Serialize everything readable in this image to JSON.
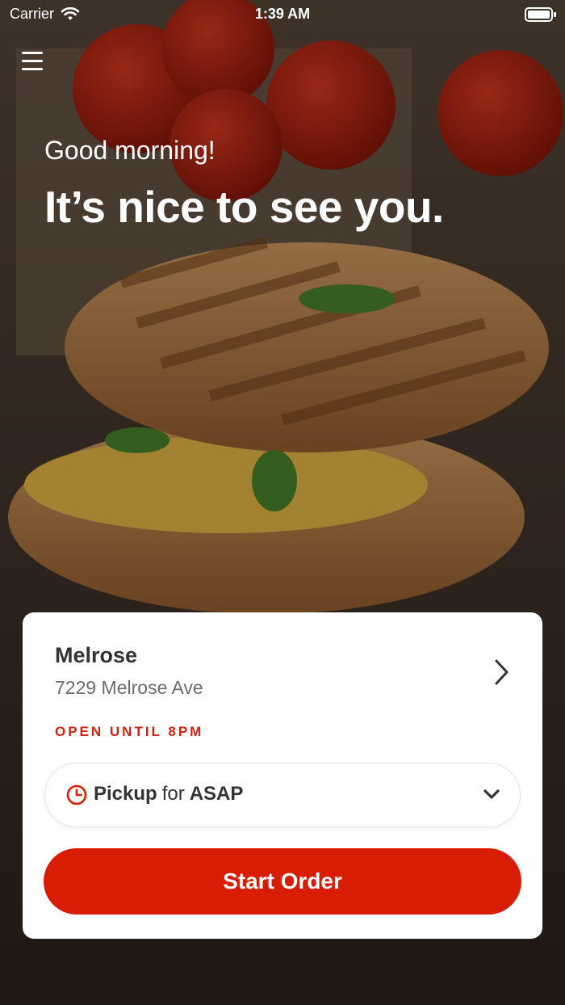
{
  "status_bar": {
    "carrier": "Carrier",
    "time": "1:39 AM"
  },
  "icons": {
    "menu": "hamburger-menu-icon",
    "wifi": "wifi-icon",
    "battery": "battery-icon",
    "chevron_right": "chevron-right-icon",
    "clock": "clock-icon",
    "chevron_down": "chevron-down-icon"
  },
  "hero": {
    "greeting": "Good morning!",
    "headline": "It’s nice to see you."
  },
  "location": {
    "name": "Melrose",
    "address": "7229 Melrose Ave",
    "hours": "OPEN UNTIL 8PM"
  },
  "order_mode": {
    "mode": "Pickup",
    "connector": "for",
    "time": "ASAP"
  },
  "start_button": {
    "label": "Start Order"
  },
  "colors": {
    "accent": "#d91c04",
    "hours_text": "#d6200f"
  }
}
